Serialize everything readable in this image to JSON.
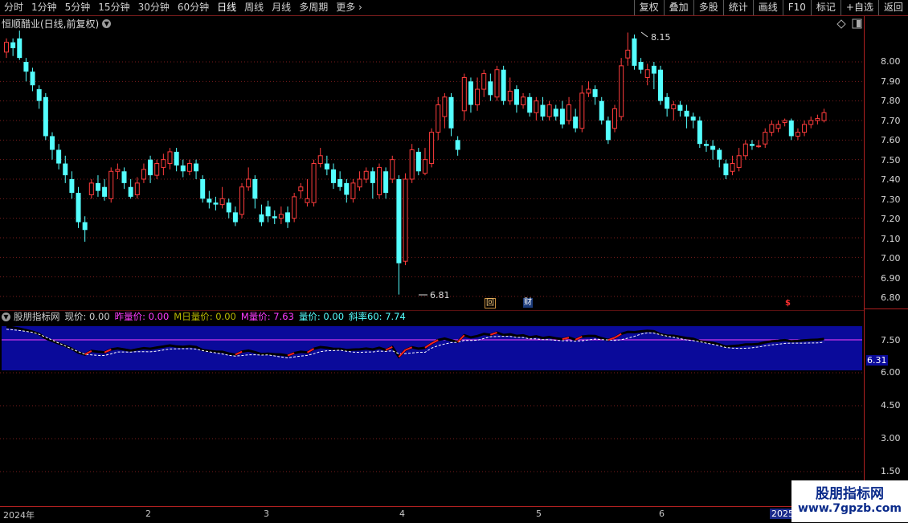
{
  "toolbar": {
    "left_items": [
      "分时",
      "1分钟",
      "5分钟",
      "15分钟",
      "30分钟",
      "60分钟",
      "日线",
      "周线",
      "月线",
      "多周期",
      "更多"
    ],
    "right_items": [
      "复权",
      "叠加",
      "多股",
      "统计",
      "画线",
      "F10",
      "标记",
      "+自选",
      "返回"
    ]
  },
  "main": {
    "title": "恒顺醋业(日线,前复权)",
    "y_labels": [
      "8.00",
      "7.90",
      "7.80",
      "7.70",
      "7.60",
      "7.50",
      "7.40",
      "7.30",
      "7.20",
      "7.10",
      "7.00",
      "6.90",
      "6.80"
    ],
    "high_label": "8.15",
    "low_label": "6.81",
    "markers": {
      "hui": "回",
      "cai": "财",
      "dollar": "$"
    },
    "colors": {
      "up": "#ff3c3c",
      "down": "#54ffff",
      "grid": "#7a1d1d"
    }
  },
  "indicator": {
    "name": "股朋指标网",
    "fields": [
      {
        "label": "现价: 0.00",
        "color": "#d0d0d0"
      },
      {
        "label": "昨量价: 0.00",
        "color": "#ff3cff"
      },
      {
        "label": "M日量价: 0.00",
        "color": "#b8b800"
      },
      {
        "label": "M量价: 7.63",
        "color": "#ff3cff"
      },
      {
        "label": "量价: 0.00",
        "color": "#54ffff"
      },
      {
        "label": "斜率60: 7.74",
        "color": "#54ffff"
      }
    ],
    "y_labels": [
      "7.50",
      "6.31",
      "6.00",
      "4.50",
      "3.00",
      "1.50"
    ],
    "colors": {
      "band": "#0a0a9a",
      "hline": "#ff40ff",
      "line": "#ffffff"
    }
  },
  "xaxis": {
    "labels": [
      "2024年",
      "2",
      "3",
      "4",
      "5",
      "6",
      "2025"
    ]
  },
  "watermark": {
    "line1": "股朋指标网",
    "line2": "www.7gpzb.com"
  },
  "chart_data": {
    "type": "candlestick",
    "ylim": [
      6.77,
      8.2
    ],
    "candles": [
      [
        8.05,
        8.1,
        8.12,
        8.02
      ],
      [
        8.1,
        8.07,
        8.12,
        8.03
      ],
      [
        8.12,
        8.02,
        8.16,
        8.01
      ],
      [
        8.0,
        7.95,
        8.02,
        7.9
      ],
      [
        7.95,
        7.88,
        7.97,
        7.85
      ],
      [
        7.86,
        7.8,
        7.88,
        7.76
      ],
      [
        7.82,
        7.62,
        7.84,
        7.6
      ],
      [
        7.62,
        7.55,
        7.64,
        7.5
      ],
      [
        7.55,
        7.48,
        7.58,
        7.45
      ],
      [
        7.48,
        7.42,
        7.52,
        7.38
      ],
      [
        7.4,
        7.33,
        7.44,
        7.3
      ],
      [
        7.33,
        7.18,
        7.36,
        7.15
      ],
      [
        7.18,
        7.14,
        7.21,
        7.08
      ],
      [
        7.32,
        7.38,
        7.4,
        7.3
      ],
      [
        7.38,
        7.34,
        7.42,
        7.31
      ],
      [
        7.36,
        7.31,
        7.4,
        7.29
      ],
      [
        7.3,
        7.44,
        7.46,
        7.28
      ],
      [
        7.44,
        7.45,
        7.48,
        7.4
      ],
      [
        7.44,
        7.38,
        7.46,
        7.35
      ],
      [
        7.36,
        7.31,
        7.4,
        7.3
      ],
      [
        7.32,
        7.38,
        7.41,
        7.3
      ],
      [
        7.4,
        7.45,
        7.48,
        7.38
      ],
      [
        7.5,
        7.42,
        7.52,
        7.38
      ],
      [
        7.42,
        7.48,
        7.5,
        7.4
      ],
      [
        7.46,
        7.5,
        7.53,
        7.42
      ],
      [
        7.48,
        7.54,
        7.56,
        7.45
      ],
      [
        7.54,
        7.47,
        7.56,
        7.44
      ],
      [
        7.47,
        7.44,
        7.5,
        7.41
      ],
      [
        7.44,
        7.48,
        7.5,
        7.42
      ],
      [
        7.48,
        7.44,
        7.5,
        7.4
      ],
      [
        7.4,
        7.3,
        7.42,
        7.28
      ],
      [
        7.3,
        7.28,
        7.34,
        7.25
      ],
      [
        7.28,
        7.27,
        7.31,
        7.24
      ],
      [
        7.27,
        7.3,
        7.36,
        7.25
      ],
      [
        7.28,
        7.23,
        7.3,
        7.2
      ],
      [
        7.23,
        7.18,
        7.26,
        7.16
      ],
      [
        7.22,
        7.36,
        7.38,
        7.2
      ],
      [
        7.36,
        7.4,
        7.46,
        7.34
      ],
      [
        7.4,
        7.3,
        7.42,
        7.25
      ],
      [
        7.22,
        7.18,
        7.27,
        7.16
      ],
      [
        7.26,
        7.21,
        7.29,
        7.18
      ],
      [
        7.21,
        7.2,
        7.24,
        7.17
      ],
      [
        7.2,
        7.22,
        7.26,
        7.17
      ],
      [
        7.23,
        7.18,
        7.26,
        7.15
      ],
      [
        7.2,
        7.31,
        7.33,
        7.18
      ],
      [
        7.34,
        7.36,
        7.38,
        7.3
      ],
      [
        7.28,
        7.3,
        7.4,
        7.26
      ],
      [
        7.28,
        7.48,
        7.5,
        7.26
      ],
      [
        7.48,
        7.52,
        7.56,
        7.46
      ],
      [
        7.48,
        7.45,
        7.52,
        7.42
      ],
      [
        7.45,
        7.38,
        7.48,
        7.35
      ],
      [
        7.4,
        7.36,
        7.44,
        7.34
      ],
      [
        7.38,
        7.32,
        7.4,
        7.28
      ],
      [
        7.3,
        7.38,
        7.4,
        7.28
      ],
      [
        7.36,
        7.4,
        7.44,
        7.34
      ],
      [
        7.4,
        7.44,
        7.46,
        7.38
      ],
      [
        7.44,
        7.38,
        7.46,
        7.3
      ],
      [
        7.32,
        7.46,
        7.48,
        7.3
      ],
      [
        7.44,
        7.33,
        7.46,
        7.3
      ],
      [
        7.4,
        7.5,
        7.52,
        7.38
      ],
      [
        7.4,
        6.97,
        7.42,
        6.81
      ],
      [
        6.98,
        7.4,
        7.43,
        6.96
      ],
      [
        7.4,
        7.55,
        7.58,
        7.38
      ],
      [
        7.54,
        7.44,
        7.56,
        7.42
      ],
      [
        7.43,
        7.5,
        7.56,
        7.42
      ],
      [
        7.48,
        7.64,
        7.66,
        7.46
      ],
      [
        7.64,
        7.78,
        7.82,
        7.6
      ],
      [
        7.72,
        7.82,
        7.84,
        7.66
      ],
      [
        7.82,
        7.66,
        7.84,
        7.62
      ],
      [
        7.6,
        7.55,
        7.62,
        7.52
      ],
      [
        7.75,
        7.92,
        7.94,
        7.7
      ],
      [
        7.9,
        7.78,
        7.92,
        7.74
      ],
      [
        7.78,
        7.86,
        7.92,
        7.75
      ],
      [
        7.86,
        7.94,
        7.96,
        7.82
      ],
      [
        7.9,
        7.83,
        7.94,
        7.8
      ],
      [
        7.82,
        7.96,
        7.98,
        7.8
      ],
      [
        7.96,
        7.8,
        7.98,
        7.78
      ],
      [
        7.8,
        7.85,
        7.92,
        7.78
      ],
      [
        7.86,
        7.78,
        7.88,
        7.74
      ],
      [
        7.78,
        7.82,
        7.84,
        7.76
      ],
      [
        7.82,
        7.74,
        7.84,
        7.72
      ],
      [
        7.74,
        7.8,
        7.82,
        7.7
      ],
      [
        7.78,
        7.72,
        7.82,
        7.7
      ],
      [
        7.72,
        7.78,
        7.8,
        7.7
      ],
      [
        7.76,
        7.72,
        7.78,
        7.7
      ],
      [
        7.76,
        7.68,
        7.8,
        7.66
      ],
      [
        7.7,
        7.78,
        7.82,
        7.68
      ],
      [
        7.72,
        7.66,
        7.76,
        7.64
      ],
      [
        7.66,
        7.84,
        7.88,
        7.64
      ],
      [
        7.84,
        7.86,
        7.9,
        7.82
      ],
      [
        7.86,
        7.82,
        7.88,
        7.78
      ],
      [
        7.8,
        7.7,
        7.82,
        7.68
      ],
      [
        7.7,
        7.6,
        7.72,
        7.58
      ],
      [
        7.66,
        7.76,
        7.78,
        7.64
      ],
      [
        7.72,
        7.98,
        8.02,
        7.7
      ],
      [
        8.02,
        8.06,
        8.15,
        7.98
      ],
      [
        8.12,
        7.98,
        8.14,
        7.96
      ],
      [
        8.0,
        7.96,
        8.02,
        7.94
      ],
      [
        7.92,
        7.96,
        7.99,
        7.88
      ],
      [
        7.98,
        7.94,
        8.0,
        7.86
      ],
      [
        7.96,
        7.8,
        7.98,
        7.78
      ],
      [
        7.82,
        7.76,
        7.84,
        7.72
      ],
      [
        7.76,
        7.78,
        7.8,
        7.7
      ],
      [
        7.78,
        7.75,
        7.8,
        7.72
      ],
      [
        7.75,
        7.72,
        7.78,
        7.66
      ],
      [
        7.72,
        7.7,
        7.74,
        7.66
      ],
      [
        7.7,
        7.58,
        7.72,
        7.56
      ],
      [
        7.58,
        7.57,
        7.6,
        7.54
      ],
      [
        7.57,
        7.55,
        7.6,
        7.5
      ],
      [
        7.55,
        7.5,
        7.56,
        7.46
      ],
      [
        7.48,
        7.42,
        7.5,
        7.4
      ],
      [
        7.44,
        7.48,
        7.52,
        7.42
      ],
      [
        7.46,
        7.52,
        7.56,
        7.44
      ],
      [
        7.52,
        7.58,
        7.6,
        7.5
      ],
      [
        7.58,
        7.57,
        7.6,
        7.55
      ],
      [
        7.57,
        7.57,
        7.6,
        7.56
      ],
      [
        7.58,
        7.64,
        7.66,
        7.56
      ],
      [
        7.64,
        7.68,
        7.7,
        7.62
      ],
      [
        7.66,
        7.68,
        7.7,
        7.64
      ],
      [
        7.69,
        7.7,
        7.71,
        7.67
      ],
      [
        7.7,
        7.62,
        7.71,
        7.6
      ],
      [
        7.62,
        7.64,
        7.66,
        7.6
      ],
      [
        7.64,
        7.68,
        7.7,
        7.62
      ],
      [
        7.68,
        7.7,
        7.72,
        7.66
      ],
      [
        7.7,
        7.71,
        7.73,
        7.68
      ],
      [
        7.7,
        7.74,
        7.76,
        7.69
      ]
    ]
  }
}
